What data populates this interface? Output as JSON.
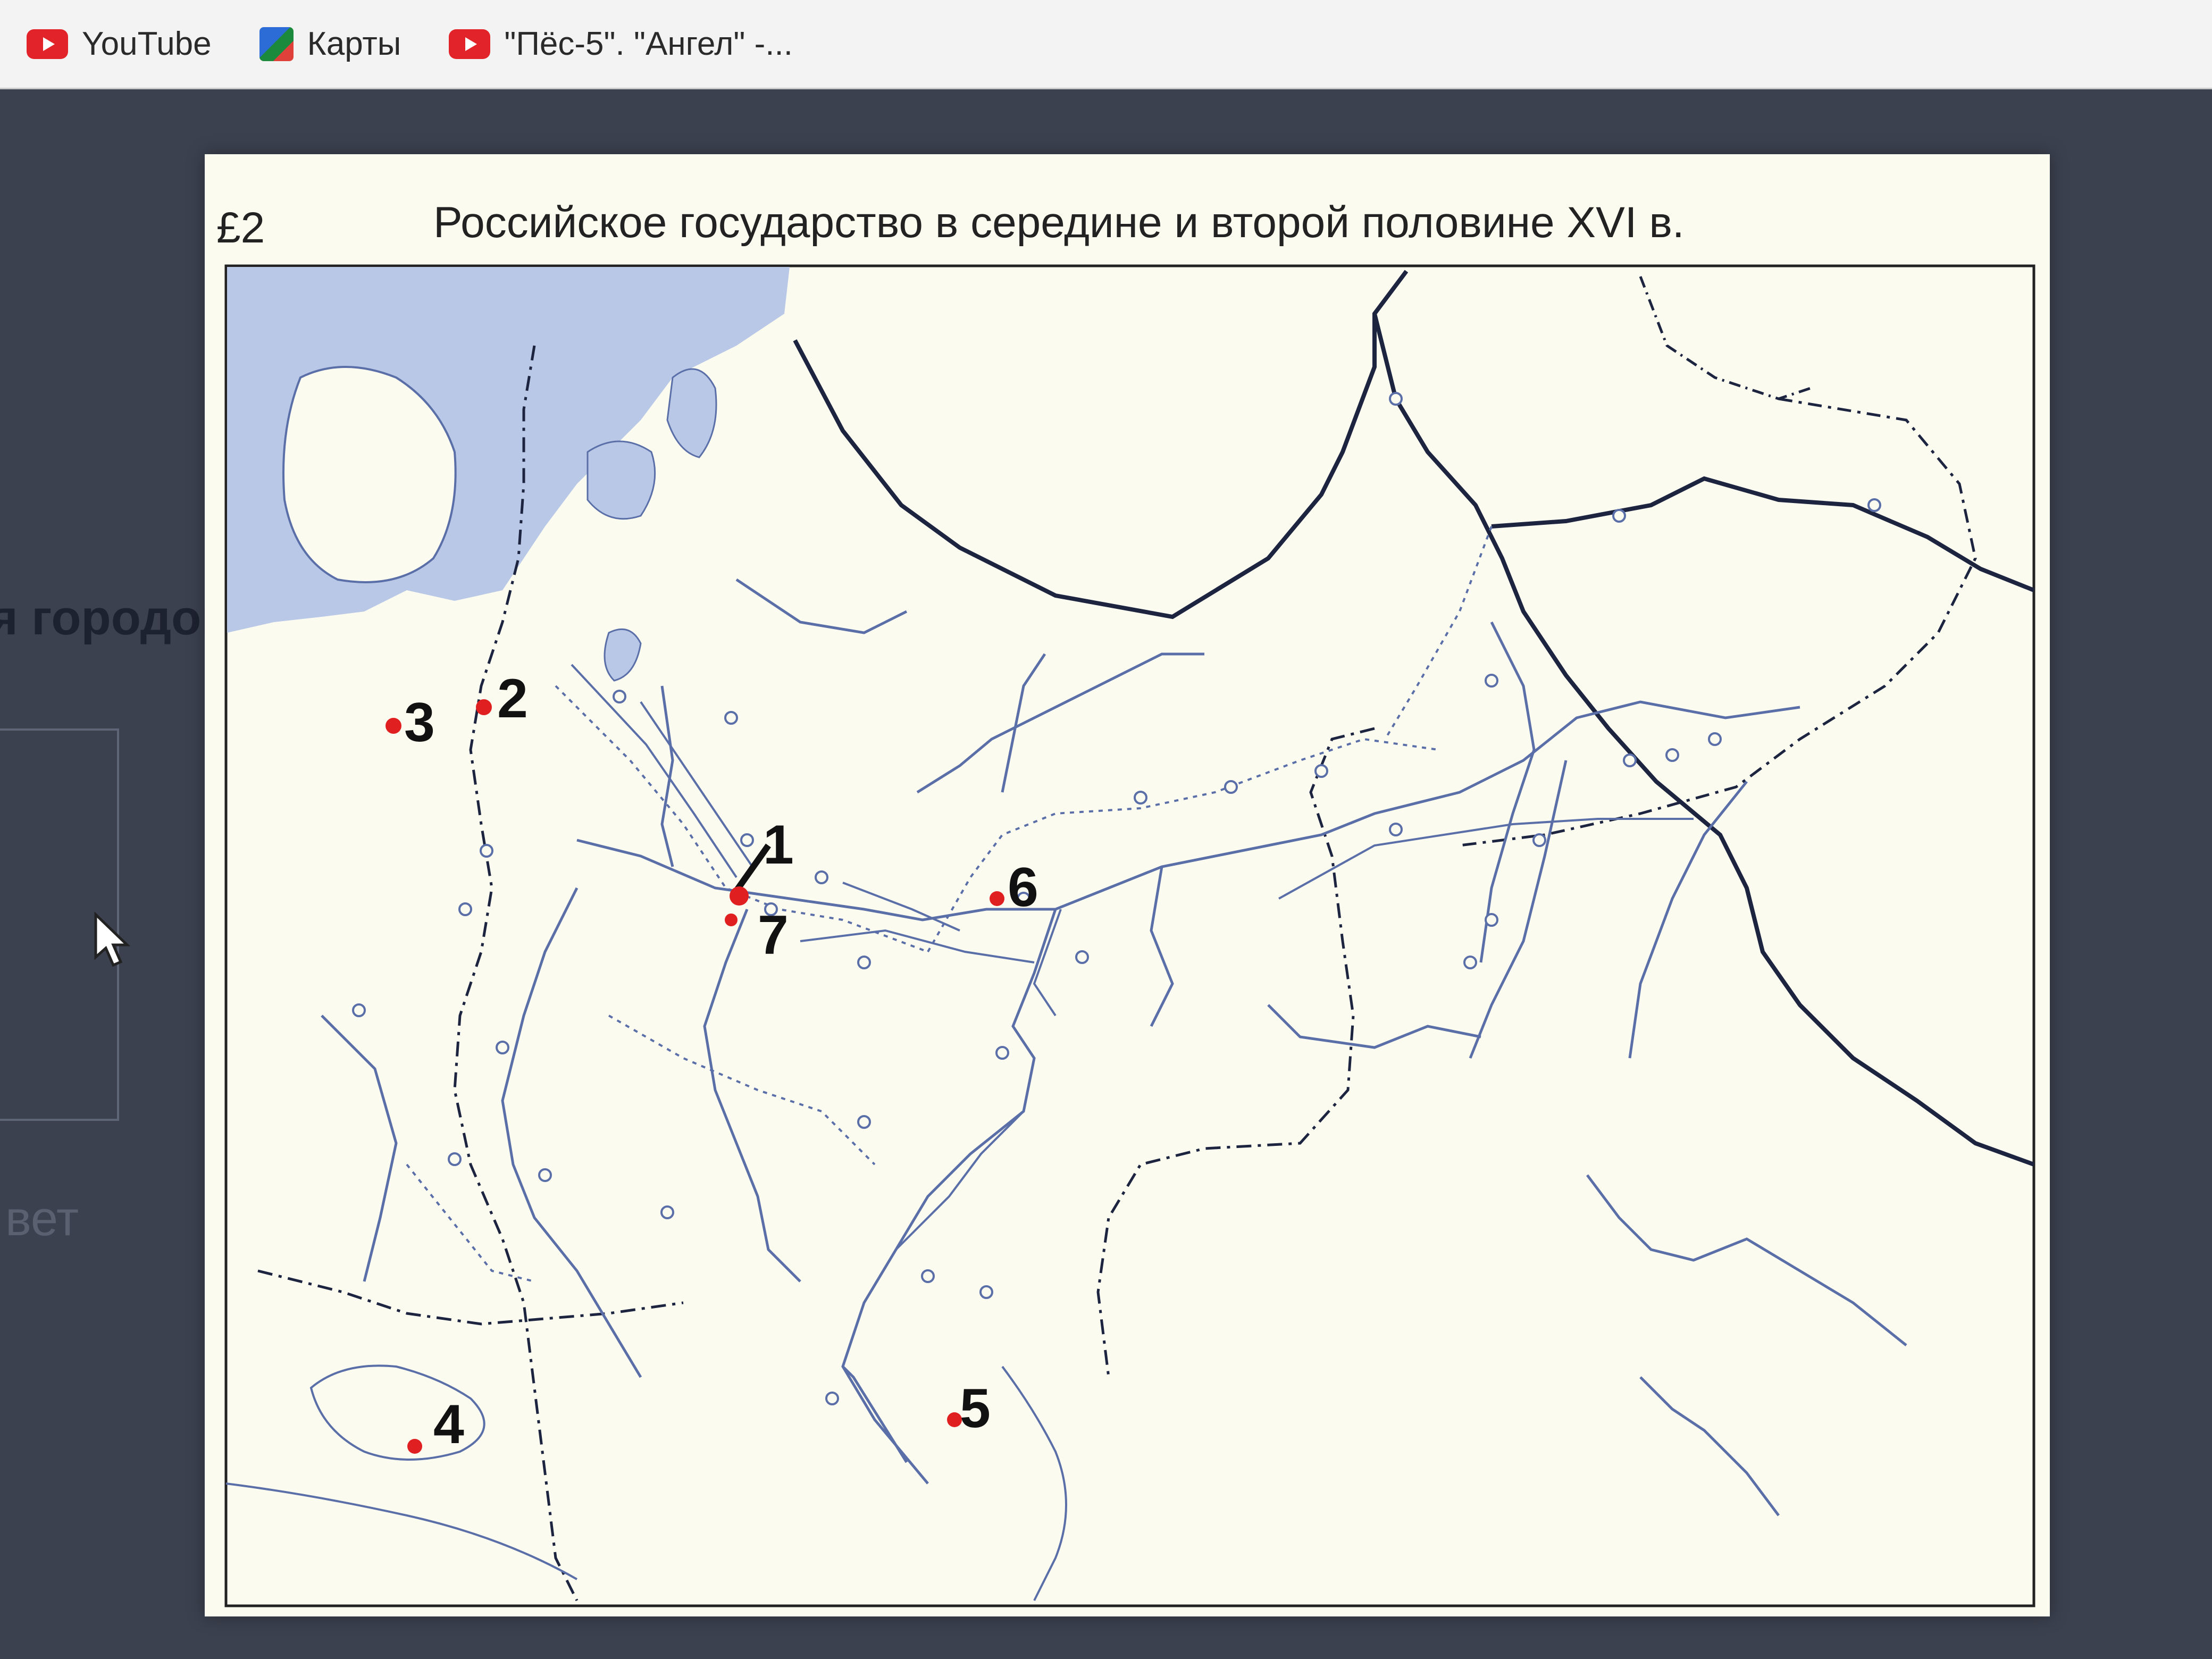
{
  "bookmarks": [
    {
      "label": "YouTube",
      "icon": "youtube-icon"
    },
    {
      "label": "Карты",
      "icon": "maps-icon"
    },
    {
      "label": "\"Пёс-5\". \"Ангел\" -...",
      "icon": "youtube-icon"
    }
  ],
  "background": {
    "left_heading": "я городов",
    "left_fragment": "вет"
  },
  "map": {
    "number": "£2",
    "title": "Российское государство в середине и второй половине XVI в.",
    "markers": [
      {
        "label": "1"
      },
      {
        "label": "2"
      },
      {
        "label": "3"
      },
      {
        "label": "4"
      },
      {
        "label": "5"
      },
      {
        "label": "6"
      },
      {
        "label": "7"
      }
    ],
    "colors": {
      "sea": "#b9c8e6",
      "land": "#fbfbf0",
      "river": "#5a6ea8",
      "border": "#1c2440",
      "marker": "#e02020"
    }
  }
}
